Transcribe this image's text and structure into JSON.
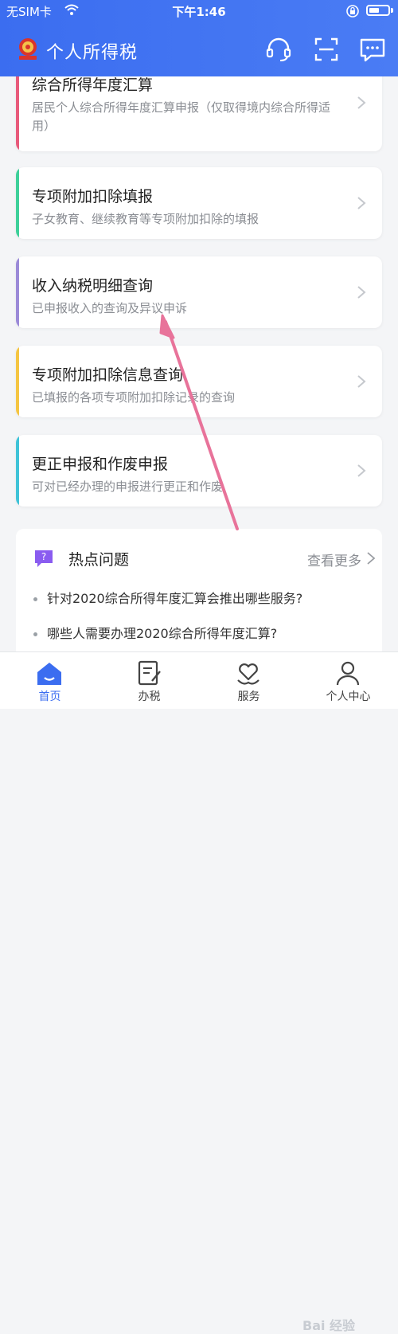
{
  "status_bar": {
    "carrier": "无SIM卡",
    "time": "下午1:46"
  },
  "header": {
    "title": "个人所得税",
    "icons": [
      "headset-icon",
      "scan-icon",
      "message-icon"
    ]
  },
  "cards": [
    {
      "title": "综合所得年度汇算",
      "desc": "居民个人综合所得年度汇算申报（仅取得境内综合所得适用）",
      "accent": "#e85a7b"
    },
    {
      "title": "专项附加扣除填报",
      "desc": "子女教育、继续教育等专项附加扣除的填报",
      "accent": "#3ed09a"
    },
    {
      "title": "收入纳税明细查询",
      "desc": "已申报收入的查询及异议申诉",
      "accent": "#9b8ad8"
    },
    {
      "title": "专项附加扣除信息查询",
      "desc": "已填报的各项专项附加扣除记录的查询",
      "accent": "#f5c542"
    },
    {
      "title": "更正申报和作废申报",
      "desc": "可对已经办理的申报进行更正和作废",
      "accent": "#3fc3d8"
    }
  ],
  "hot": {
    "title": "热点问题",
    "more": "查看更多",
    "items": [
      "针对2020综合所得年度汇算会推出哪些服务?",
      "哪些人需要办理2020综合所得年度汇算?"
    ]
  },
  "tabs": [
    {
      "label": "首页",
      "icon": "home-icon",
      "active": true
    },
    {
      "label": "办税",
      "icon": "tax-form-icon",
      "active": false
    },
    {
      "label": "服务",
      "icon": "heart-hand-icon",
      "active": false
    },
    {
      "label": "个人中心",
      "icon": "person-icon",
      "active": false
    }
  ],
  "colors": {
    "brand": "#3b6df0",
    "annotation_arrow": "#e8739a"
  },
  "watermark": "Bai 经验"
}
